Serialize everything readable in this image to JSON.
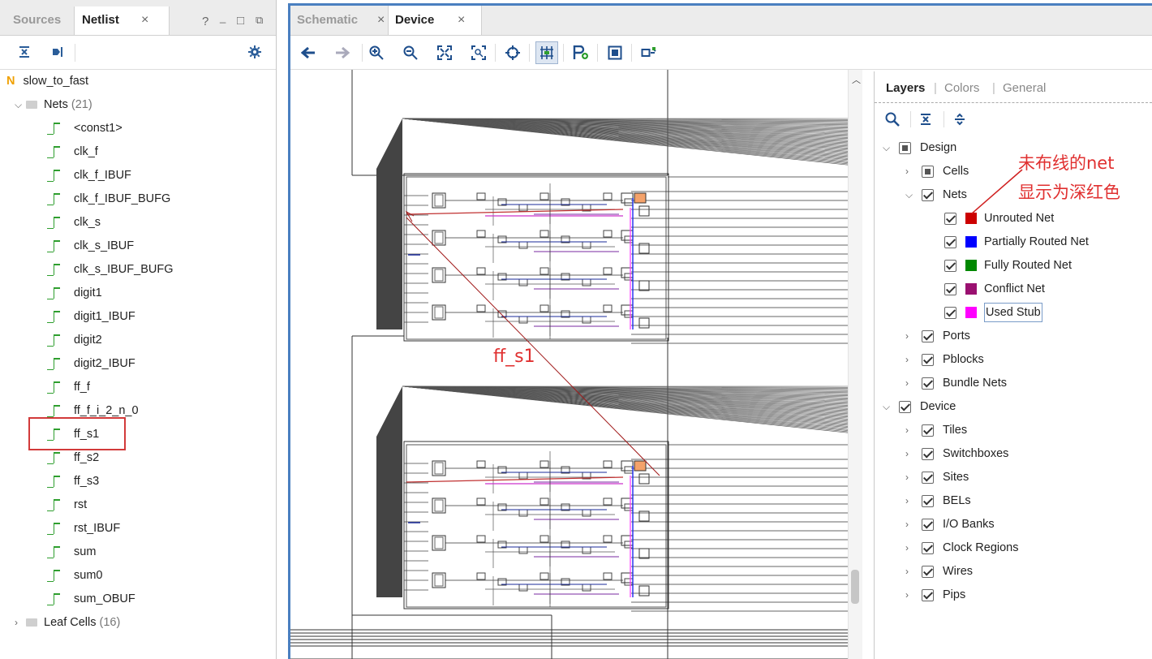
{
  "left_panel": {
    "tabs": [
      {
        "label": "Sources"
      },
      {
        "label": "Netlist"
      }
    ],
    "window_controls": {
      "help": "?",
      "minimize": "_",
      "restore": "□"
    },
    "tree": {
      "root": "slow_to_fast",
      "root_badge": "N",
      "nets_label": "Nets",
      "nets_count": "(21)",
      "nets": [
        "<const1>",
        "clk_f",
        "clk_f_IBUF",
        "clk_f_IBUF_BUFG",
        "clk_s",
        "clk_s_IBUF",
        "clk_s_IBUF_BUFG",
        "digit1",
        "digit1_IBUF",
        "digit2",
        "digit2_IBUF",
        "ff_f",
        "ff_f_i_2_n_0",
        "ff_s1",
        "ff_s2",
        "ff_s3",
        "rst",
        "rst_IBUF",
        "sum",
        "sum0",
        "sum_OBUF"
      ],
      "leaf_label": "Leaf Cells",
      "leaf_count": "(16)"
    },
    "highlighted_net": "ff_s1"
  },
  "main_panel": {
    "tabs": [
      {
        "label": "Schematic"
      },
      {
        "label": "Device"
      }
    ],
    "active_tab": "Device",
    "toolbar_icons": [
      "back-icon",
      "forward-icon",
      "zoom-in-icon",
      "zoom-out-icon",
      "fit-icon",
      "zoom-selection-icon",
      "crosshair-icon",
      "routing-resources-icon",
      "add-pblock-icon",
      "pblock-icon",
      "autofit-icon"
    ],
    "canvas_label": "ff_s1",
    "accent_color": "#4a7fc0"
  },
  "layers_panel": {
    "tabs": [
      {
        "label": "Layers"
      },
      {
        "label": "Colors"
      },
      {
        "label": "General"
      }
    ],
    "items": [
      {
        "label": "Design",
        "level": 0,
        "expanded": true,
        "state": "partial"
      },
      {
        "label": "Cells",
        "level": 1,
        "expanded": false,
        "state": "partial"
      },
      {
        "label": "Nets",
        "level": 1,
        "expanded": true,
        "state": "checked"
      },
      {
        "label": "Unrouted Net",
        "level": 2,
        "state": "checked",
        "color": "#cc0000"
      },
      {
        "label": "Partially Routed Net",
        "level": 2,
        "state": "checked",
        "color": "#0000ff"
      },
      {
        "label": "Fully Routed Net",
        "level": 2,
        "state": "checked",
        "color": "#008800"
      },
      {
        "label": "Conflict Net",
        "level": 2,
        "state": "checked",
        "color": "#9a1070"
      },
      {
        "label": "Used Stub",
        "level": 2,
        "state": "checked",
        "color": "#ff00ff"
      },
      {
        "label": "Ports",
        "level": 1,
        "expanded": false,
        "state": "checked"
      },
      {
        "label": "Pblocks",
        "level": 1,
        "expanded": false,
        "state": "checked"
      },
      {
        "label": "Bundle Nets",
        "level": 1,
        "expanded": false,
        "state": "checked"
      },
      {
        "label": "Device",
        "level": 0,
        "expanded": true,
        "state": "checked"
      },
      {
        "label": "Tiles",
        "level": 1,
        "expanded": false,
        "state": "checked"
      },
      {
        "label": "Switchboxes",
        "level": 1,
        "expanded": false,
        "state": "checked"
      },
      {
        "label": "Sites",
        "level": 1,
        "expanded": false,
        "state": "checked"
      },
      {
        "label": "BELs",
        "level": 1,
        "expanded": false,
        "state": "checked"
      },
      {
        "label": "I/O Banks",
        "level": 1,
        "expanded": false,
        "state": "checked"
      },
      {
        "label": "Clock Regions",
        "level": 1,
        "expanded": false,
        "state": "checked"
      },
      {
        "label": "Wires",
        "level": 1,
        "expanded": false,
        "state": "checked"
      },
      {
        "label": "Pips",
        "level": 1,
        "expanded": false,
        "state": "checked"
      }
    ],
    "annotation_line1": "未布线的net",
    "annotation_line2": "显示为深红色",
    "annotation_color": "#e03030"
  }
}
